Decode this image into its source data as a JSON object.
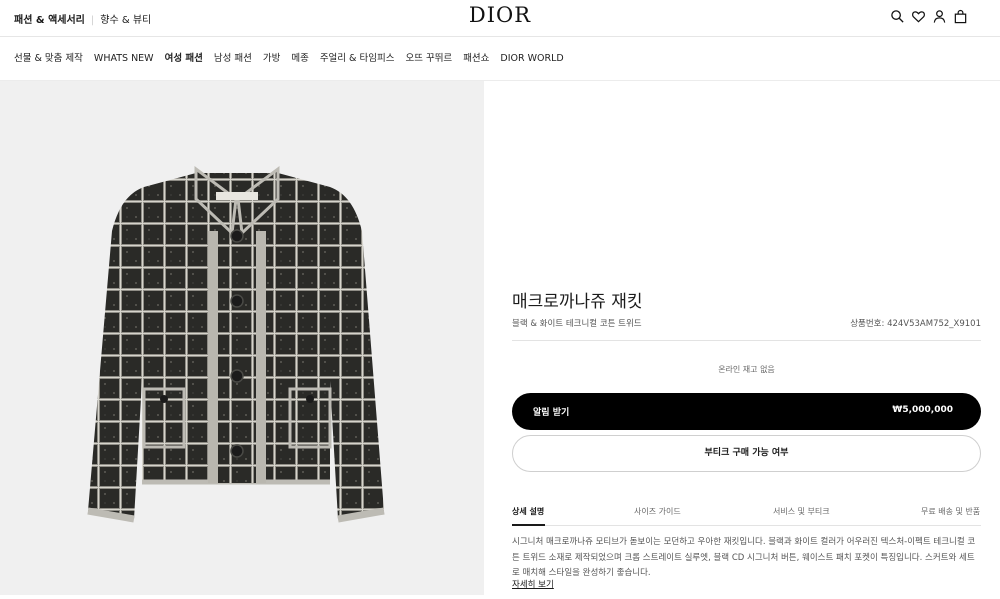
{
  "header": {
    "left_links": [
      "패션 & 액세서리",
      "향수 & 뷰티"
    ],
    "logo": "DIOR",
    "icons": [
      "search-icon",
      "heart-icon",
      "user-icon",
      "shopping-bag-icon"
    ]
  },
  "nav": {
    "items": [
      "선물 & 맞춤 제작",
      "WHATS NEW",
      "여성 패션",
      "남성 패션",
      "가방",
      "메종",
      "주얼리 & 타임피스",
      "오뜨 꾸뛰르",
      "패션쇼",
      "DIOR WORLD"
    ],
    "active": "여성 패션"
  },
  "product": {
    "title": "매크로까나쥬 재킷",
    "subtitle": "블랙 & 화이트 테크니컬 코튼 트위드",
    "reference": "상품번호: 424V53AM752_X9101",
    "stock": "온라인 재고 없음",
    "notify_label": "알림 받기",
    "price": "₩5,000,000",
    "boutique_label": "부티크 구매 가능 여부",
    "tabs": [
      "상세 설명",
      "사이즈 가이드",
      "서비스 및 부티크",
      "무료 배송 및 반품"
    ],
    "description": "시그니처 매크로까나쥬 모티브가 돋보이는 모던하고 우아한 재킷입니다. 블랙과 화이트 컬러가 어우러진 텍스처-이펙트 테크니컬 코튼 트위드 소재로 제작되었으며 크롭 스트레이트 실루엣, 블랙 CD 시그니처 버튼, 웨이스트 패치 포켓이 특징입니다. 스커트와 세트로 매치해 스타일을 완성하기 좋습니다.",
    "more_link": "자세히 보기"
  },
  "colors": {
    "gallery_bg": "#f0f0f0",
    "primary_button": "#000000"
  }
}
